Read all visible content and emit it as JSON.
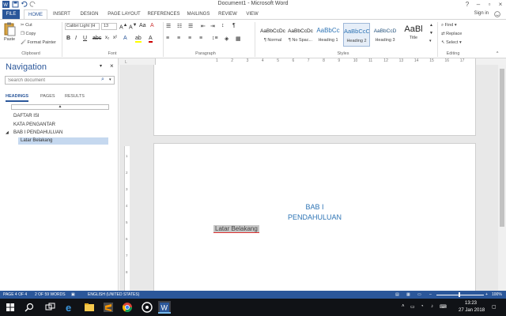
{
  "window": {
    "title": "Document1 - Microsoft Word",
    "sign_in": "Sign in"
  },
  "tabs": [
    "FILE",
    "HOME",
    "INSERT",
    "DESIGN",
    "PAGE LAYOUT",
    "REFERENCES",
    "MAILINGS",
    "REVIEW",
    "VIEW"
  ],
  "ribbon": {
    "clipboard": {
      "label": "Clipboard",
      "paste": "Paste",
      "cut": "Cut",
      "copy": "Copy",
      "format_painter": "Format Painter"
    },
    "font": {
      "label": "Font",
      "family": "Calibri Light (H",
      "size": "13"
    },
    "paragraph": {
      "label": "Paragraph"
    },
    "styles": {
      "label": "Styles",
      "items": [
        {
          "preview": "AaBbCcDc",
          "name": "¶ Normal"
        },
        {
          "preview": "AaBbCcDc",
          "name": "¶ No Spac..."
        },
        {
          "preview": "AaBbCc",
          "name": "Heading 1"
        },
        {
          "preview": "AaBbCcC",
          "name": "Heading 2"
        },
        {
          "preview": "AaBbCcD",
          "name": "Heading 3"
        },
        {
          "preview": "AaBl",
          "name": "Title"
        }
      ]
    },
    "editing": {
      "label": "Editing",
      "find": "Find",
      "replace": "Replace",
      "select": "Select"
    }
  },
  "navigation": {
    "title": "Navigation",
    "search_placeholder": "Search document",
    "tabs": [
      "HEADINGS",
      "PAGES",
      "RESULTS"
    ],
    "items": [
      {
        "label": "DAFTAR ISI"
      },
      {
        "label": "KATA PENGANTAR"
      },
      {
        "label": "BAB I PENDAHULUAN"
      },
      {
        "label": "Latar Belakang"
      }
    ]
  },
  "ruler": {
    "numbers": [
      "1",
      "2",
      "3",
      "4",
      "5",
      "6",
      "7",
      "8",
      "9",
      "10",
      "11",
      "12",
      "13",
      "14",
      "15",
      "16",
      "17"
    ]
  },
  "vruler": {
    "numbers": [
      "1",
      "2",
      "3",
      "4",
      "5",
      "6",
      "7",
      "8"
    ]
  },
  "document": {
    "heading_line1": "BAB I",
    "heading_line2": "PENDAHULUAN",
    "subheading": "Latar Belakang"
  },
  "status": {
    "page": "PAGE 4 OF 4",
    "words": "2 OF 59 WORDS",
    "language": "ENGLISH (UNITED STATES)",
    "zoom": "100%"
  },
  "taskbar": {
    "time": "13:23",
    "date": "27 Jan 2018"
  },
  "colors": {
    "accent": "#2b579a",
    "heading": "#2e74b5",
    "taskbar": "#101216"
  }
}
